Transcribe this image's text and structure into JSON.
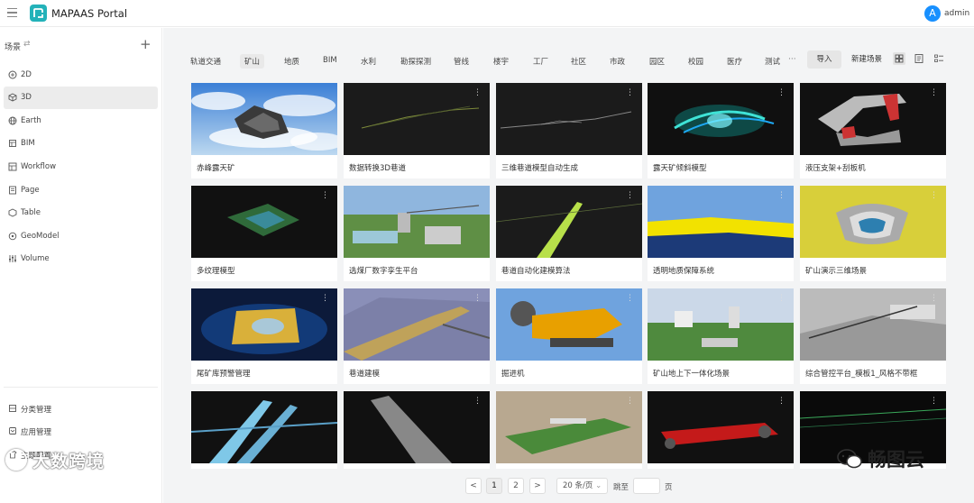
{
  "header": {
    "app_title": "MAPAAS Portal",
    "avatar_letter": "A",
    "user_name": "admin"
  },
  "sidebar": {
    "section_label": "场景",
    "items": [
      {
        "label": "2D",
        "icon": "2d-icon"
      },
      {
        "label": "3D",
        "icon": "cube-icon",
        "active": true
      },
      {
        "label": "Earth",
        "icon": "globe-icon"
      },
      {
        "label": "BIM",
        "icon": "building-icon"
      },
      {
        "label": "Workflow",
        "icon": "workflow-icon"
      },
      {
        "label": "Page",
        "icon": "page-icon"
      },
      {
        "label": "Table",
        "icon": "table-icon"
      },
      {
        "label": "GeoModel",
        "icon": "geomodel-icon"
      },
      {
        "label": "Volume",
        "icon": "volume-icon"
      }
    ],
    "bottom_items": [
      {
        "label": "分类管理",
        "icon": "category-icon"
      },
      {
        "label": "应用管理",
        "icon": "app-icon"
      },
      {
        "label": "主题配置",
        "icon": "theme-icon"
      }
    ],
    "watermark": "大数跨境"
  },
  "tabs": [
    "轨道交通",
    "矿山",
    "地质",
    "BIM",
    "水利",
    "勘探探测",
    "管线",
    "楼宇",
    "工厂",
    "社区",
    "市政",
    "园区",
    "校园",
    "医疗",
    "测试"
  ],
  "active_tab": "矿山",
  "toolbar": {
    "more": "···",
    "import_label": "导入",
    "new_scene_label": "新建场景"
  },
  "cards": [
    "赤峰露天矿",
    "数据转换3D巷道",
    "三维巷道模型自动生成",
    "露天矿倾斜模型",
    "液压支架+刮板机",
    "多纹理模型",
    "选煤厂数字孪生平台",
    "巷道自动化建模算法",
    "透明地质保障系统",
    "矿山演示三维场景",
    "尾矿库预警管理",
    "巷道建模",
    "掘进机",
    "矿山地上下一体化场景",
    "综合管控平台_模板1_风格不带框",
    "",
    "",
    "",
    "",
    ""
  ],
  "pagination": {
    "prev": "<",
    "page1": "1",
    "page2": "2",
    "next": ">",
    "page_size": "20 条/页",
    "goto_label": "跳至",
    "page_suffix": "页"
  },
  "watermark_right": "畅图云",
  "colors": {
    "accent": "#23b2b9",
    "avatar": "#1890ff"
  }
}
